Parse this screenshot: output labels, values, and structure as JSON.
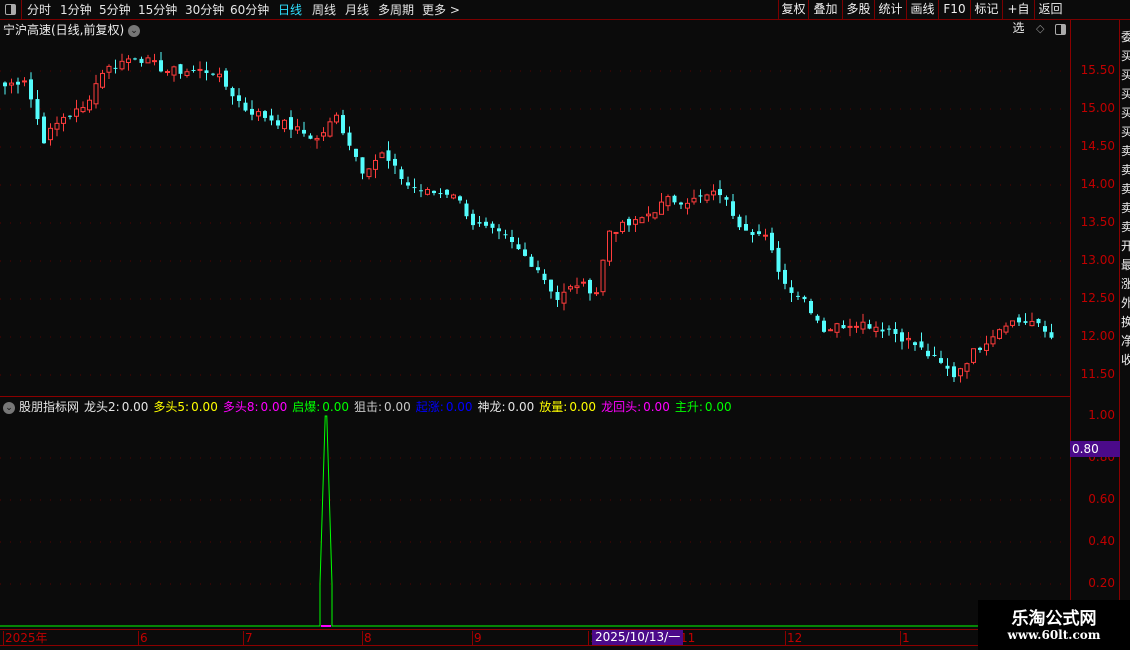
{
  "toolbar": {
    "periods": [
      "分时",
      "1分钟",
      "5分钟",
      "15分钟",
      "30分钟",
      "60分钟",
      "日线",
      "周线",
      "月线",
      "多周期",
      "更多 >"
    ],
    "active_period": "日线",
    "right_buttons": [
      "复权",
      "叠加",
      "多股",
      "统计",
      "画线",
      "F10",
      "标记",
      "+自选",
      "返回"
    ]
  },
  "stock_title": "宁沪高速(日线,前复权)",
  "indicator": {
    "name": "股朋指标网",
    "items": [
      {
        "label": "龙头2:",
        "value": "0.00",
        "color": "#e6e6e6"
      },
      {
        "label": "多头5:",
        "value": "0.00",
        "color": "#ffff00"
      },
      {
        "label": "多头8:",
        "value": "0.00",
        "color": "#ff00ff"
      },
      {
        "label": "启爆:",
        "value": "0.00",
        "color": "#00ff00"
      },
      {
        "label": "狙击:",
        "value": "0.00",
        "color": "#c8c8c8"
      },
      {
        "label": "起涨:",
        "value": "0.00",
        "color": "#0000ff"
      },
      {
        "label": "神龙:",
        "value": "0.00",
        "color": "#e6e6e6"
      },
      {
        "label": "放量:",
        "value": "0.00",
        "color": "#ffff00"
      },
      {
        "label": "龙回头:",
        "value": "0.00",
        "color": "#ff00ff"
      },
      {
        "label": "主升:",
        "value": "0.00",
        "color": "#00ff00"
      }
    ],
    "cursor_value": "0.80"
  },
  "date_axis": {
    "labels": [
      "2025年",
      "6",
      "7",
      "8",
      "9",
      "1",
      "11",
      "12",
      "1"
    ],
    "cursor_date": "2025/10/13/一"
  },
  "watermark": {
    "title": "乐淘公式网",
    "url": "www.60lt.com"
  },
  "chart_data": [
    {
      "type": "candlestick",
      "title": "宁沪高速(日线,前复权)",
      "y_ticks": [
        "15.50",
        "15.00",
        "14.50",
        "14.00",
        "13.50",
        "13.00",
        "12.50",
        "12.00",
        "11.50"
      ],
      "ylim": [
        11.3,
        15.95
      ],
      "up_color": "#ff3c3c",
      "down_color": "#54fcfc",
      "close_keyframes_by_bar": [
        [
          0,
          15.3
        ],
        [
          3,
          15.4
        ],
        [
          6,
          14.6
        ],
        [
          9,
          14.9
        ],
        [
          12,
          15.0
        ],
        [
          15,
          15.5
        ],
        [
          20,
          15.7
        ],
        [
          25,
          15.5
        ],
        [
          32,
          15.5
        ],
        [
          37,
          15.0
        ],
        [
          43,
          14.8
        ],
        [
          48,
          14.6
        ],
        [
          51,
          14.9
        ],
        [
          55,
          14.2
        ],
        [
          58,
          14.4
        ],
        [
          62,
          14.0
        ],
        [
          65,
          13.9
        ],
        [
          69,
          13.9
        ],
        [
          72,
          13.5
        ],
        [
          77,
          13.3
        ],
        [
          82,
          12.9
        ],
        [
          85,
          12.5
        ],
        [
          88,
          12.7
        ],
        [
          91,
          12.6
        ],
        [
          93,
          13.4
        ],
        [
          97,
          13.5
        ],
        [
          102,
          13.8
        ],
        [
          106,
          13.8
        ],
        [
          110,
          13.9
        ],
        [
          113,
          13.5
        ],
        [
          117,
          13.3
        ],
        [
          120,
          12.7
        ],
        [
          123,
          12.5
        ],
        [
          126,
          12.1
        ],
        [
          131,
          12.2
        ],
        [
          136,
          12.1
        ],
        [
          140,
          11.9
        ],
        [
          146,
          11.5
        ],
        [
          149,
          11.8
        ],
        [
          154,
          12.2
        ],
        [
          158,
          12.2
        ],
        [
          161,
          12.0
        ]
      ]
    },
    {
      "type": "line",
      "y_ticks": [
        "1.00",
        "0.80",
        "0.60",
        "0.40",
        "0.20"
      ],
      "ylim": [
        0,
        1.05
      ],
      "spike_levels": [
        0.2,
        0.4,
        0.6,
        0.8,
        1.0
      ],
      "spike_color": "#00ff00",
      "baseline_color": "#00ff00"
    }
  ],
  "right_strip_chars": [
    "委",
    "买",
    "买",
    "买",
    "买",
    "买",
    "卖",
    "卖",
    "卖",
    "卖",
    "卖",
    "开",
    "最",
    "涨",
    "外",
    "换",
    "净",
    "收"
  ]
}
